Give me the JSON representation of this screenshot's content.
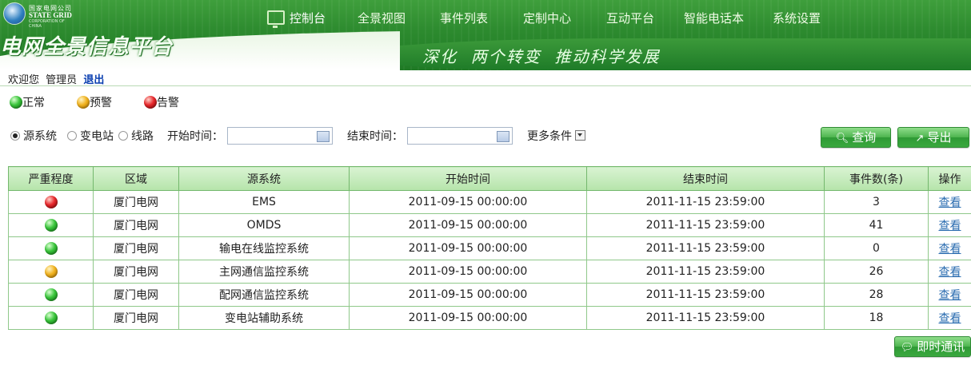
{
  "header": {
    "logo": {
      "cn": "国家电网公司",
      "en": "STATE GRID",
      "sub": "CORPORATION OF CHINA"
    },
    "title": "电网全景信息平台",
    "slogan": "深化  两个转变  推动科学发展",
    "nav": [
      {
        "label": "控制台",
        "icon": "monitor-icon",
        "active": true
      },
      {
        "label": "全景视图"
      },
      {
        "label": "事件列表"
      },
      {
        "label": "定制中心"
      },
      {
        "label": "互动平台"
      },
      {
        "label": "智能电话本"
      },
      {
        "label": "系统设置"
      }
    ]
  },
  "welcome": {
    "greeting": "欢迎您",
    "user": "管理员",
    "logout": "退出"
  },
  "legend": [
    {
      "label": "正常",
      "color": "green"
    },
    {
      "label": "预警",
      "color": "yellow"
    },
    {
      "label": "告警",
      "color": "red"
    }
  ],
  "filters": {
    "radios": [
      {
        "label": "源系统",
        "checked": true
      },
      {
        "label": "变电站",
        "checked": false
      },
      {
        "label": "线路",
        "checked": false
      }
    ],
    "start_label": "开始时间：",
    "start_value": "",
    "end_label": "结束时间：",
    "end_value": "",
    "more_label": "更多条件",
    "query_button": "查询",
    "export_button": "导出"
  },
  "table": {
    "columns": [
      "严重程度",
      "区域",
      "源系统",
      "开始时间",
      "结束时间",
      "事件数(条)",
      "操作"
    ],
    "rows": [
      {
        "severity": "red",
        "region": "厦门电网",
        "source": "EMS",
        "start": "2011-09-15 00:00:00",
        "end": "2011-11-15 23:59:00",
        "count": "3",
        "action": "查看"
      },
      {
        "severity": "green",
        "region": "厦门电网",
        "source": "OMDS",
        "start": "2011-09-15 00:00:00",
        "end": "2011-11-15 23:59:00",
        "count": "41",
        "action": "查看"
      },
      {
        "severity": "green",
        "region": "厦门电网",
        "source": "输电在线监控系统",
        "start": "2011-09-15 00:00:00",
        "end": "2011-11-15 23:59:00",
        "count": "0",
        "action": "查看"
      },
      {
        "severity": "yellow",
        "region": "厦门电网",
        "source": "主网通信监控系统",
        "start": "2011-09-15 00:00:00",
        "end": "2011-11-15 23:59:00",
        "count": "26",
        "action": "查看"
      },
      {
        "severity": "green",
        "region": "厦门电网",
        "source": "配网通信监控系统",
        "start": "2011-09-15 00:00:00",
        "end": "2011-11-15 23:59:00",
        "count": "28",
        "action": "查看"
      },
      {
        "severity": "green",
        "region": "厦门电网",
        "source": "变电站辅助系统",
        "start": "2011-09-15 00:00:00",
        "end": "2011-11-15 23:59:00",
        "count": "18",
        "action": "查看"
      }
    ]
  },
  "chat_button": "即时通讯",
  "colors": {
    "brand_green": "#2c8a2e",
    "link_blue": "#2a6cb0",
    "logout_blue": "#0a3fb0"
  }
}
